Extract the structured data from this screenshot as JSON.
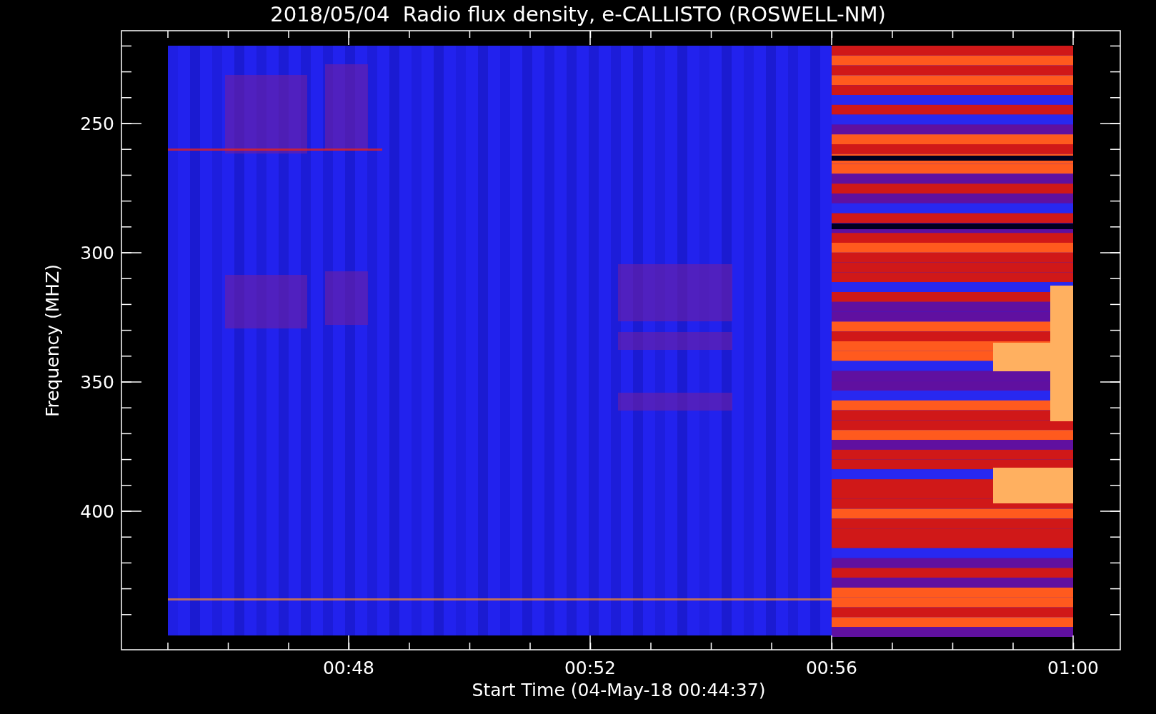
{
  "plot": {
    "title": "2018/05/04  Radio flux density, e-CALLISTO (ROSWELL-NM)",
    "xlabel": "Start Time (04-May-18 00:44:37)",
    "ylabel": "Frequency (MHZ)",
    "xticks": [
      "00:48",
      "00:52",
      "00:56",
      "01:00"
    ],
    "yticks": [
      "250",
      "300",
      "350",
      "400"
    ]
  }
}
